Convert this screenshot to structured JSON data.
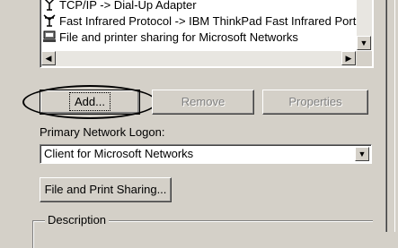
{
  "components_list": {
    "items": [
      {
        "label": "TCP/IP -> Dial-Up Adapter",
        "icon": "network-protocol-icon"
      },
      {
        "label": "Fast Infrared Protocol -> IBM ThinkPad Fast Infrared Port",
        "icon": "network-protocol-icon"
      },
      {
        "label": "File and printer sharing for Microsoft Networks",
        "icon": "network-service-icon"
      }
    ]
  },
  "buttons": {
    "add": "Add...",
    "remove": "Remove",
    "properties": "Properties",
    "file_print_sharing": "File and Print Sharing..."
  },
  "logon": {
    "label": "Primary Network Logon:",
    "value": "Client for Microsoft Networks"
  },
  "description": {
    "title": "Description"
  },
  "colors": {
    "face": "#d4d0c8",
    "shadow": "#808080",
    "disabled_text": "#808080"
  }
}
